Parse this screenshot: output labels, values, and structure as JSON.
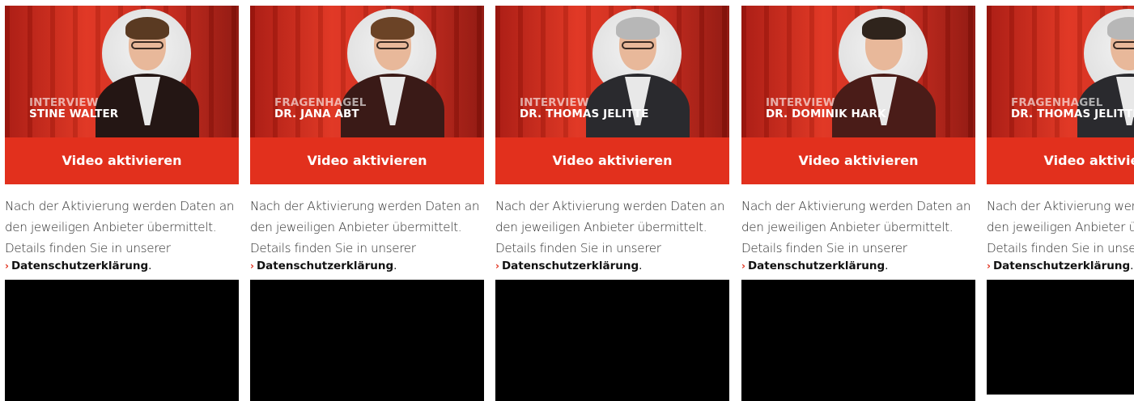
{
  "cards": [
    {
      "overline": "INTERVIEW",
      "name": "STINE WALTER",
      "button_label": "Video aktivieren",
      "desc_lines": [
        "Nach der Aktivierung werden Daten an",
        "den jeweiligen Anbieter übermittelt.",
        "Details finden Sie in unserer"
      ],
      "privacy_link": "Datenschutzerklärung",
      "privacy_suffix": ".",
      "hair_color": "#5a3a22",
      "body_color": "#241614"
    },
    {
      "overline": "FRAGENHAGEL",
      "name": "DR. JANA ABT",
      "button_label": "Video aktivieren",
      "desc_lines": [
        "Nach der Aktivierung werden Daten an",
        "den jeweiligen Anbieter übermittelt.",
        "Details finden Sie in unserer"
      ],
      "privacy_link": "Datenschutzerklärung",
      "privacy_suffix": ".",
      "hair_color": "#6b4326",
      "body_color": "#3a1a17"
    },
    {
      "overline": "INTERVIEW",
      "name": "DR. THOMAS JELITTE",
      "button_label": "Video aktivieren",
      "desc_lines": [
        "Nach der Aktivierung werden Daten an",
        "den jeweiligen Anbieter übermittelt.",
        "Details finden Sie in unserer"
      ],
      "privacy_link": "Datenschutzerklärung",
      "privacy_suffix": ".",
      "hair_color": "#b7b7b7",
      "body_color": "#2a2a2e"
    },
    {
      "overline": "INTERVIEW",
      "name": "DR. DOMINIK HARK",
      "button_label": "Video aktivieren",
      "desc_lines": [
        "Nach der Aktivierung werden Daten an",
        "den jeweiligen Anbieter übermittelt.",
        "Details finden Sie in unserer"
      ],
      "privacy_link": "Datenschutzerklärung",
      "privacy_suffix": ".",
      "hair_color": "#2f241c",
      "body_color": "#4a1c18"
    },
    {
      "overline": "FRAGENHAGEL",
      "name": "DR. THOMAS JELITTE",
      "button_label": "Video aktivieren",
      "desc_lines": [
        "Nach der Aktivierung werden Daten an",
        "den jeweiligen Anbieter übermittelt.",
        "Details finden Sie in unserer"
      ],
      "privacy_link": "Datenschutzerklärung",
      "privacy_suffix": ".",
      "hair_color": "#b7b7b7",
      "body_color": "#2a2a2e"
    }
  ],
  "colors": {
    "accent": "#e2301d",
    "video_placeholder": "#000000"
  }
}
